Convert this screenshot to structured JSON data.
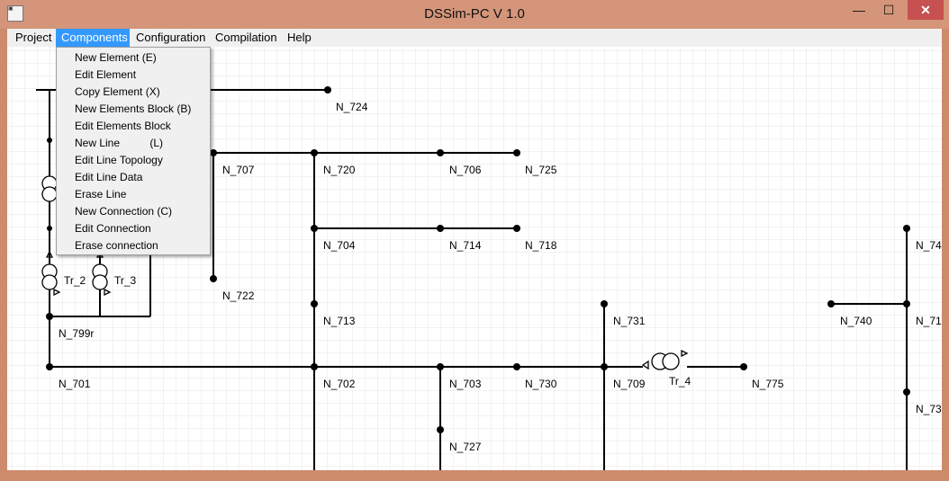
{
  "window": {
    "title": "DSSim-PC V 1.0",
    "icon": "dssim-app-icon",
    "min_glyph": "—",
    "max_glyph": "☐",
    "close_glyph": "✕",
    "frame_color": "#cd8b6c",
    "accent_color": "#3399ff"
  },
  "menu": {
    "project": "Project",
    "components": "Components",
    "configuration": "Configuration",
    "compilation": "Compilation",
    "help": "Help"
  },
  "components_menu": {
    "items": [
      "New Element (E)",
      "Edit Element",
      "Copy Element (X)",
      "New Elements Block (B)",
      "Edit Elements Block",
      "New Line          (L)",
      "Edit Line Topology",
      "Edit Line Data",
      "Erase Line",
      "New Connection (C)",
      "Edit Connection",
      "Erase connection"
    ]
  },
  "diagram": {
    "node_labels": {
      "n724": "N_724",
      "n707": "N_707",
      "n720": "N_720",
      "n706": "N_706",
      "n725": "N_725",
      "n704": "N_704",
      "n714": "N_714",
      "n718": "N_718",
      "n722": "N_722",
      "n713": "N_713",
      "n731": "N_731",
      "n740": "N_740",
      "n799r": "N_799r",
      "n701": "N_701",
      "n702": "N_702",
      "n703": "N_703",
      "n730": "N_730",
      "n709": "N_709",
      "n775": "N_775",
      "n727": "N_727",
      "n74x": "N_74",
      "n71x": "N_71",
      "n73x": "N_73"
    },
    "transformer_labels": {
      "tr2": "Tr_2",
      "tr3": "Tr_3",
      "tr4": "Tr_4"
    }
  }
}
